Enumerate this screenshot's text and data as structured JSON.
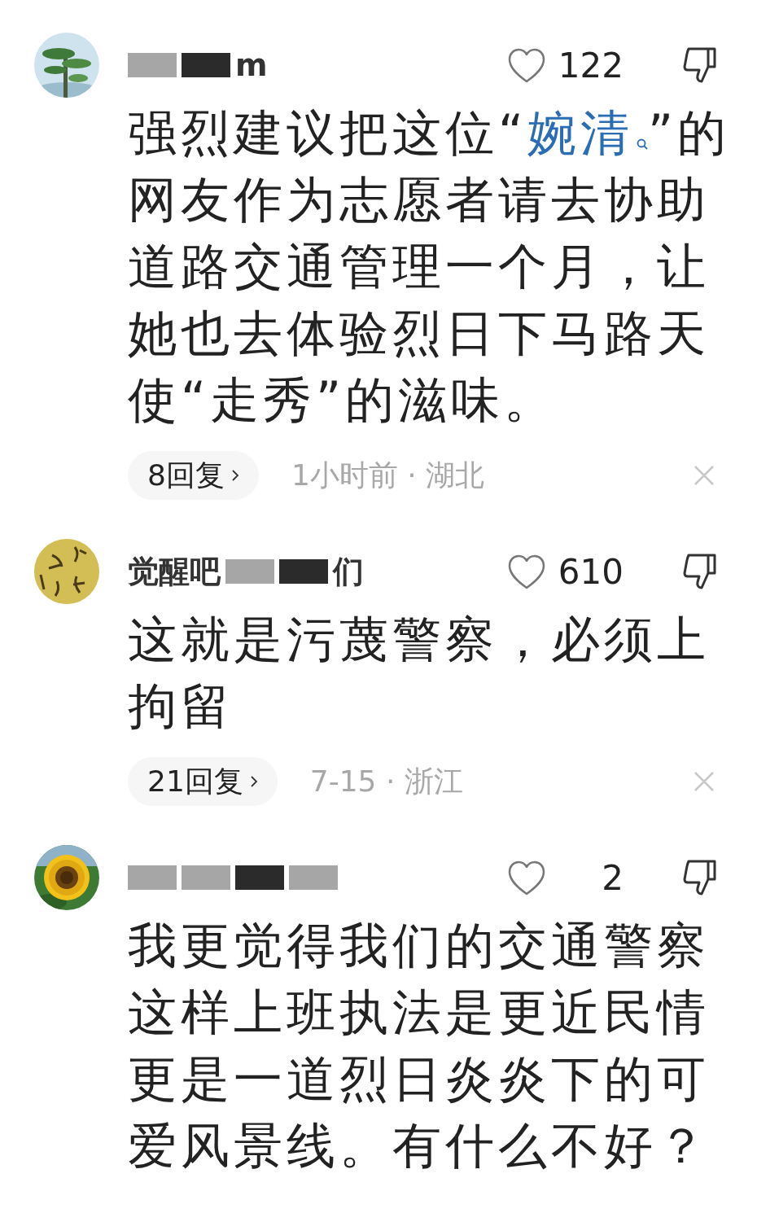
{
  "comments": [
    {
      "name_parts": [
        {
          "kind": "grey-block"
        },
        {
          "kind": "dark-block"
        },
        {
          "kind": "text",
          "text": "m"
        }
      ],
      "likes": "122",
      "body": [
        {
          "kind": "text",
          "text": "强烈建议把这位“"
        },
        {
          "kind": "link",
          "text": "婉清"
        },
        {
          "kind": "text",
          "text": "”的网友作为志愿者请去协助道路交通管理一个月，让她也去体验烈日下马路天使“走秀”的滋味。"
        }
      ],
      "replies": "8回复",
      "time": "1小时前 · 湖北"
    },
    {
      "name_parts": [
        {
          "kind": "text",
          "text": "觉醒吧"
        },
        {
          "kind": "grey-block"
        },
        {
          "kind": "dark-block"
        },
        {
          "kind": "text",
          "text": "们"
        }
      ],
      "likes": "610",
      "body": [
        {
          "kind": "text",
          "text": "这就是污蔑警察，必须上拘留"
        }
      ],
      "replies": "21回复",
      "time": "7-15 · 浙江"
    },
    {
      "name_parts": [
        {
          "kind": "grey-block"
        },
        {
          "kind": "grey-block"
        },
        {
          "kind": "dark-block"
        },
        {
          "kind": "grey-block"
        }
      ],
      "likes": "2",
      "body": [
        {
          "kind": "text",
          "text": "我更觉得我们的交通警察这样上班执法是更近民情更是一道烈日炎炎下的可爱风景线。有什么不好？"
        }
      ]
    }
  ]
}
